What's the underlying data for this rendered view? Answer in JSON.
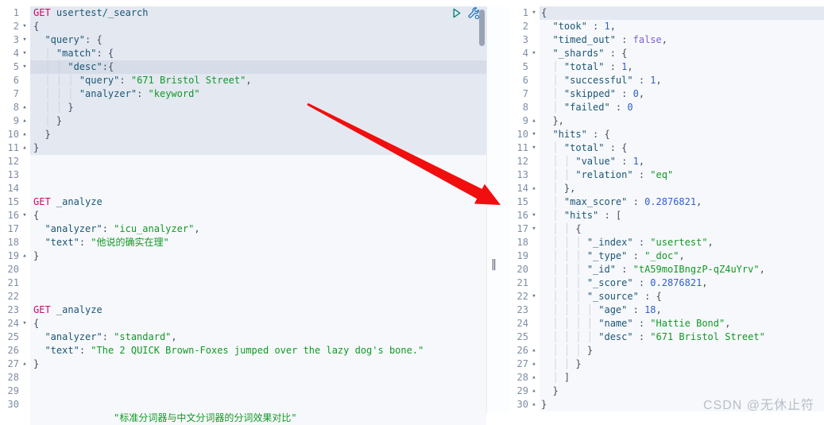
{
  "glyphs": {
    "fold_open": "▾",
    "fold_close": "▴",
    "splitter": "‖",
    "play_icon": "play-icon",
    "wrench_icon": "wrench-icon"
  },
  "colors": {
    "accent_method": "#c80a68",
    "key": "#1b5776",
    "string": "#0f9a26",
    "number": "#2e5fd0",
    "boolean": "#7b61d6",
    "highlight_block": "#e3e8f1",
    "current_line": "#d6dce8",
    "arrow": "#f10e0e"
  },
  "watermark": "CSDN @无休止符",
  "request_editor": {
    "lines": [
      {
        "n": "1",
        "seg": [
          [
            "m",
            "GET "
          ],
          [
            "u",
            "usertest/_search"
          ]
        ],
        "hl": 1
      },
      {
        "n": "2",
        "f": "v",
        "seg": [
          [
            "p",
            "{"
          ]
        ],
        "hl": 1
      },
      {
        "n": "3",
        "f": "v",
        "seg": [
          [
            "p",
            "  "
          ],
          [
            "k",
            "\"query\""
          ],
          [
            "p",
            ": {"
          ]
        ],
        "hl": 1
      },
      {
        "n": "4",
        "f": "v",
        "seg": [
          [
            "p",
            "  "
          ],
          [
            "g",
            "│ "
          ],
          [
            "k",
            "\"match\""
          ],
          [
            "p",
            ": {"
          ]
        ],
        "hl": 1
      },
      {
        "n": "5",
        "f": "v",
        "seg": [
          [
            "p",
            "  "
          ],
          [
            "g",
            "│ │ "
          ],
          [
            "k",
            "\"desc\""
          ],
          [
            "p",
            ":{"
          ]
        ],
        "hl": 1,
        "cur": 1
      },
      {
        "n": "6",
        "seg": [
          [
            "p",
            "  "
          ],
          [
            "g",
            "│ │ │ "
          ],
          [
            "k",
            "\"query\""
          ],
          [
            "p",
            ": "
          ],
          [
            "s",
            "\"671 Bristol Street\""
          ],
          [
            "p",
            ","
          ]
        ],
        "hl": 1
      },
      {
        "n": "7",
        "seg": [
          [
            "p",
            "  "
          ],
          [
            "g",
            "│ │ │ "
          ],
          [
            "k",
            "\"analyzer\""
          ],
          [
            "p",
            ": "
          ],
          [
            "s",
            "\"keyword\""
          ]
        ],
        "hl": 1
      },
      {
        "n": "8",
        "f": "^",
        "seg": [
          [
            "p",
            "  "
          ],
          [
            "g",
            "│ │ "
          ],
          [
            "p",
            "}"
          ]
        ],
        "hl": 1
      },
      {
        "n": "9",
        "f": "^",
        "seg": [
          [
            "p",
            "  "
          ],
          [
            "g",
            "│ "
          ],
          [
            "p",
            "}"
          ]
        ],
        "hl": 1
      },
      {
        "n": "10",
        "f": "^",
        "seg": [
          [
            "p",
            "  }"
          ]
        ],
        "hl": 1
      },
      {
        "n": "11",
        "f": "^",
        "seg": [
          [
            "p",
            "}"
          ]
        ],
        "hl": 1
      },
      {
        "n": "12"
      },
      {
        "n": "13"
      },
      {
        "n": "14"
      },
      {
        "n": "15",
        "seg": [
          [
            "m",
            "GET "
          ],
          [
            "u",
            "_analyze"
          ]
        ]
      },
      {
        "n": "16",
        "f": "v",
        "seg": [
          [
            "p",
            "{"
          ]
        ]
      },
      {
        "n": "17",
        "seg": [
          [
            "p",
            "  "
          ],
          [
            "k",
            "\"analyzer\""
          ],
          [
            "p",
            ": "
          ],
          [
            "s",
            "\"icu_analyzer\""
          ],
          [
            "p",
            ","
          ]
        ]
      },
      {
        "n": "18",
        "seg": [
          [
            "p",
            "  "
          ],
          [
            "k",
            "\"text\""
          ],
          [
            "p",
            ": "
          ],
          [
            "s",
            "\"他说的确实在理\""
          ]
        ]
      },
      {
        "n": "19",
        "f": "^",
        "seg": [
          [
            "p",
            "}"
          ]
        ]
      },
      {
        "n": "20"
      },
      {
        "n": "21"
      },
      {
        "n": "22"
      },
      {
        "n": "23",
        "seg": [
          [
            "m",
            "GET "
          ],
          [
            "u",
            "_analyze"
          ]
        ]
      },
      {
        "n": "24",
        "f": "v",
        "seg": [
          [
            "p",
            "{"
          ]
        ]
      },
      {
        "n": "25",
        "seg": [
          [
            "p",
            "  "
          ],
          [
            "k",
            "\"analyzer\""
          ],
          [
            "p",
            ": "
          ],
          [
            "s",
            "\"standard\""
          ],
          [
            "p",
            ","
          ]
        ]
      },
      {
        "n": "26",
        "seg": [
          [
            "p",
            "  "
          ],
          [
            "k",
            "\"text\""
          ],
          [
            "p",
            ": "
          ],
          [
            "s",
            "\"The 2 QUICK Brown-Foxes jumped over the lazy dog's bone.\""
          ]
        ]
      },
      {
        "n": "27",
        "f": "^",
        "seg": [
          [
            "p",
            "}"
          ]
        ]
      },
      {
        "n": "28"
      },
      {
        "n": "29"
      },
      {
        "n": "30"
      },
      {
        "n": "",
        "seg": [
          [
            "p",
            "              "
          ],
          [
            "s",
            "\"标准分词器与中文分词器的分词效果对比\""
          ]
        ]
      }
    ]
  },
  "response_viewer": {
    "lines": [
      {
        "n": "1",
        "f": "v",
        "seg": [
          [
            "p",
            "{"
          ]
        ],
        "hl": 1
      },
      {
        "n": "2",
        "seg": [
          [
            "p",
            "  "
          ],
          [
            "k",
            "\"took\""
          ],
          [
            "p",
            " : "
          ],
          [
            "n",
            "1"
          ],
          [
            "p",
            ","
          ]
        ]
      },
      {
        "n": "3",
        "seg": [
          [
            "p",
            "  "
          ],
          [
            "k",
            "\"timed_out\""
          ],
          [
            "p",
            " : "
          ],
          [
            "b",
            "false"
          ],
          [
            "p",
            ","
          ]
        ]
      },
      {
        "n": "4",
        "f": "v",
        "seg": [
          [
            "p",
            "  "
          ],
          [
            "k",
            "\"_shards\""
          ],
          [
            "p",
            " : {"
          ]
        ]
      },
      {
        "n": "5",
        "seg": [
          [
            "p",
            "  "
          ],
          [
            "g",
            "│ "
          ],
          [
            "k",
            "\"total\""
          ],
          [
            "p",
            " : "
          ],
          [
            "n",
            "1"
          ],
          [
            "p",
            ","
          ]
        ]
      },
      {
        "n": "6",
        "seg": [
          [
            "p",
            "  "
          ],
          [
            "g",
            "│ "
          ],
          [
            "k",
            "\"successful\""
          ],
          [
            "p",
            " : "
          ],
          [
            "n",
            "1"
          ],
          [
            "p",
            ","
          ]
        ]
      },
      {
        "n": "7",
        "seg": [
          [
            "p",
            "  "
          ],
          [
            "g",
            "│ "
          ],
          [
            "k",
            "\"skipped\""
          ],
          [
            "p",
            " : "
          ],
          [
            "n",
            "0"
          ],
          [
            "p",
            ","
          ]
        ]
      },
      {
        "n": "8",
        "seg": [
          [
            "p",
            "  "
          ],
          [
            "g",
            "│ "
          ],
          [
            "k",
            "\"failed\""
          ],
          [
            "p",
            " : "
          ],
          [
            "n",
            "0"
          ]
        ]
      },
      {
        "n": "9",
        "f": "^",
        "seg": [
          [
            "p",
            "  },"
          ]
        ]
      },
      {
        "n": "10",
        "f": "v",
        "seg": [
          [
            "p",
            "  "
          ],
          [
            "k",
            "\"hits\""
          ],
          [
            "p",
            " : {"
          ]
        ]
      },
      {
        "n": "11",
        "f": "v",
        "seg": [
          [
            "p",
            "  "
          ],
          [
            "g",
            "│ "
          ],
          [
            "k",
            "\"total\""
          ],
          [
            "p",
            " : {"
          ]
        ]
      },
      {
        "n": "12",
        "seg": [
          [
            "p",
            "  "
          ],
          [
            "g",
            "│ │ "
          ],
          [
            "k",
            "\"value\""
          ],
          [
            "p",
            " : "
          ],
          [
            "n",
            "1"
          ],
          [
            "p",
            ","
          ]
        ]
      },
      {
        "n": "13",
        "seg": [
          [
            "p",
            "  "
          ],
          [
            "g",
            "│ │ "
          ],
          [
            "k",
            "\"relation\""
          ],
          [
            "p",
            " : "
          ],
          [
            "s",
            "\"eq\""
          ]
        ]
      },
      {
        "n": "14",
        "f": "^",
        "seg": [
          [
            "p",
            "  "
          ],
          [
            "g",
            "│ "
          ],
          [
            "p",
            "},"
          ]
        ]
      },
      {
        "n": "15",
        "seg": [
          [
            "p",
            "  "
          ],
          [
            "g",
            "│ "
          ],
          [
            "k",
            "\"max_score\""
          ],
          [
            "p",
            " : "
          ],
          [
            "n",
            "0.2876821"
          ],
          [
            "p",
            ","
          ]
        ]
      },
      {
        "n": "16",
        "f": "v",
        "seg": [
          [
            "p",
            "  "
          ],
          [
            "g",
            "│ "
          ],
          [
            "k",
            "\"hits\""
          ],
          [
            "p",
            " : ["
          ]
        ]
      },
      {
        "n": "17",
        "f": "v",
        "seg": [
          [
            "p",
            "  "
          ],
          [
            "g",
            "│ │ "
          ],
          [
            "p",
            "{"
          ]
        ]
      },
      {
        "n": "18",
        "seg": [
          [
            "p",
            "  "
          ],
          [
            "g",
            "│ │ │ "
          ],
          [
            "k",
            "\"_index\""
          ],
          [
            "p",
            " : "
          ],
          [
            "s",
            "\"usertest\""
          ],
          [
            "p",
            ","
          ]
        ]
      },
      {
        "n": "19",
        "seg": [
          [
            "p",
            "  "
          ],
          [
            "g",
            "│ │ │ "
          ],
          [
            "k",
            "\"_type\""
          ],
          [
            "p",
            " : "
          ],
          [
            "s",
            "\"_doc\""
          ],
          [
            "p",
            ","
          ]
        ]
      },
      {
        "n": "20",
        "seg": [
          [
            "p",
            "  "
          ],
          [
            "g",
            "│ │ │ "
          ],
          [
            "k",
            "\"_id\""
          ],
          [
            "p",
            " : "
          ],
          [
            "s",
            "\"tA59moIBngzP-qZ4uYrv\""
          ],
          [
            "p",
            ","
          ]
        ]
      },
      {
        "n": "21",
        "seg": [
          [
            "p",
            "  "
          ],
          [
            "g",
            "│ │ │ "
          ],
          [
            "k",
            "\"_score\""
          ],
          [
            "p",
            " : "
          ],
          [
            "n",
            "0.2876821"
          ],
          [
            "p",
            ","
          ]
        ]
      },
      {
        "n": "22",
        "f": "v",
        "seg": [
          [
            "p",
            "  "
          ],
          [
            "g",
            "│ │ │ "
          ],
          [
            "k",
            "\"_source\""
          ],
          [
            "p",
            " : {"
          ]
        ]
      },
      {
        "n": "23",
        "seg": [
          [
            "p",
            "  "
          ],
          [
            "g",
            "│ │ │ │ "
          ],
          [
            "k",
            "\"age\""
          ],
          [
            "p",
            " : "
          ],
          [
            "n",
            "18"
          ],
          [
            "p",
            ","
          ]
        ]
      },
      {
        "n": "24",
        "seg": [
          [
            "p",
            "  "
          ],
          [
            "g",
            "│ │ │ │ "
          ],
          [
            "k",
            "\"name\""
          ],
          [
            "p",
            " : "
          ],
          [
            "s",
            "\"Hattie Bond\""
          ],
          [
            "p",
            ","
          ]
        ]
      },
      {
        "n": "25",
        "seg": [
          [
            "p",
            "  "
          ],
          [
            "g",
            "│ │ │ │ "
          ],
          [
            "k",
            "\"desc\""
          ],
          [
            "p",
            " : "
          ],
          [
            "s",
            "\"671 Bristol Street\""
          ]
        ]
      },
      {
        "n": "26",
        "f": "^",
        "seg": [
          [
            "p",
            "  "
          ],
          [
            "g",
            "│ │ │ "
          ],
          [
            "p",
            "}"
          ]
        ]
      },
      {
        "n": "27",
        "f": "^",
        "seg": [
          [
            "p",
            "  "
          ],
          [
            "g",
            "│ │ "
          ],
          [
            "p",
            "}"
          ]
        ]
      },
      {
        "n": "28",
        "f": "^",
        "seg": [
          [
            "p",
            "  "
          ],
          [
            "g",
            "│ "
          ],
          [
            "p",
            "]"
          ]
        ]
      },
      {
        "n": "29",
        "f": "^",
        "seg": [
          [
            "p",
            "  }"
          ]
        ]
      },
      {
        "n": "30",
        "f": "^",
        "seg": [
          [
            "p",
            "}"
          ]
        ]
      }
    ]
  }
}
